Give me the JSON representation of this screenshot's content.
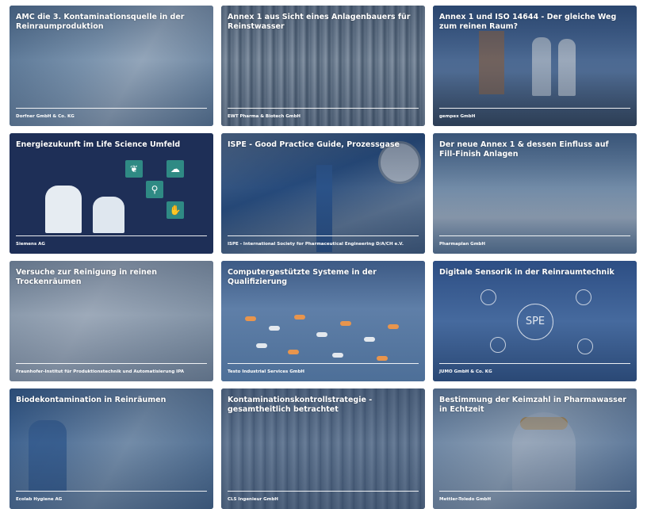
{
  "cards": [
    {
      "title": "AMC die 3. Kontaminationsquelle in der Reinraumproduktion",
      "company": "Dorfner GmbH & Co. KG"
    },
    {
      "title": "Annex 1 aus Sicht eines Anlagenbauers für Reinstwasser",
      "company": "EWT Pharma & Biotech GmbH"
    },
    {
      "title": "Annex 1 und ISO 14644 - Der gleiche Weg zum reinen Raum?",
      "company": "gempex GmbH"
    },
    {
      "title": "Energiezukunft im Life Science Umfeld",
      "company": "Siemens AG"
    },
    {
      "title": "ISPE - Good Practice Guide, Prozessgase",
      "company": "ISPE - International Society for Pharmaceutical Engineering D/A/CH e.V."
    },
    {
      "title": "Der neue Annex 1 & dessen Einfluss auf Fill-Finish Anlagen",
      "company": "Pharmaplan GmbH"
    },
    {
      "title": "Versuche zur Reinigung in reinen Trockenräumen",
      "company": "Fraunhofer-Institut für Produktionstechnik und Automatisierung IPA"
    },
    {
      "title": "Computergestützte Systeme in der Qualifizierung",
      "company": "Testo Industrial Services GmbH"
    },
    {
      "title": "Digitale Sensorik in der Reinraumtechnik",
      "company": "JUMO GmbH & Co. KG"
    },
    {
      "title": "Biodekontamination in Reinräumen",
      "company": "Ecolab Hygiene AG"
    },
    {
      "title": "Kontaminationskontrollstrategie - gesamtheitlich betrachtet",
      "company": "CLS Ingenieur GmbH"
    },
    {
      "title": "Bestimmung der Keimzahl in Pharmawasser in Echtzeit",
      "company": "Mettler-Toledo GmbH"
    }
  ],
  "decor": {
    "spe_label": "SPE",
    "icons": [
      "leaf-icon",
      "cloud-icon",
      "magnifier-icon",
      "hand-icon"
    ]
  },
  "colors": {
    "card_overlay": "#23395c",
    "icon_tile": "#2f8a84",
    "text": "#ffffff"
  }
}
